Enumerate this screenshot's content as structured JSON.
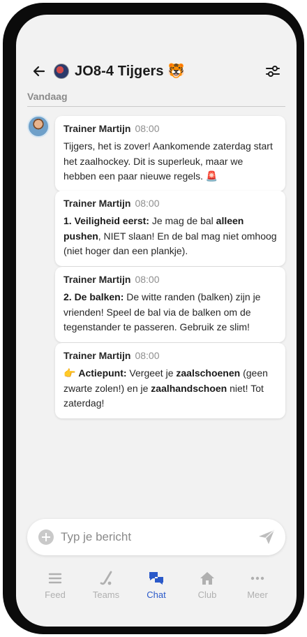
{
  "header": {
    "title": "JO8-4 Tijgers 🐯"
  },
  "chat": {
    "day_label": "Vandaag",
    "messages": [
      {
        "sender": "Trainer Martijn",
        "time": "08:00",
        "parts": [
          {
            "t": "Tijgers, het is zover! Aankomende zaterdag start het zaalhockey. Dit is superleuk, maar we hebben een paar nieuwe regels. 🚨",
            "b": false
          }
        ]
      },
      {
        "sender": "Trainer Martijn",
        "time": "08:00",
        "parts": [
          {
            "t": "1. Veiligheid eerst:",
            "b": true
          },
          {
            "t": " Je mag de bal ",
            "b": false
          },
          {
            "t": "alleen pushen",
            "b": true
          },
          {
            "t": ", NIET slaan! En de bal mag niet omhoog (niet hoger dan een plankje).",
            "b": false
          }
        ]
      },
      {
        "sender": "Trainer Martijn",
        "time": "08:00",
        "parts": [
          {
            "t": "2. De balken:",
            "b": true
          },
          {
            "t": " De witte randen (balken) zijn je vrienden! Speel de bal via de balken om de tegenstander te passeren. Gebruik ze slim!",
            "b": false
          }
        ]
      },
      {
        "sender": "Trainer Martijn",
        "time": "08:00",
        "parts": [
          {
            "t": "👉 ",
            "b": false
          },
          {
            "t": "Actiepunt:",
            "b": true
          },
          {
            "t": " Vergeet je ",
            "b": false
          },
          {
            "t": "zaalschoenen",
            "b": true
          },
          {
            "t": " (geen zwarte zolen!) en je ",
            "b": false
          },
          {
            "t": "zaalhandschoen",
            "b": true
          },
          {
            "t": " niet! Tot zaterdag!",
            "b": false
          }
        ]
      }
    ]
  },
  "composer": {
    "placeholder": "Typ je bericht"
  },
  "tabs": [
    {
      "label": "Feed",
      "icon": "feed-icon",
      "active": false
    },
    {
      "label": "Teams",
      "icon": "hockey-stick-icon",
      "active": false
    },
    {
      "label": "Chat",
      "icon": "chat-bubbles-icon",
      "active": true
    },
    {
      "label": "Club",
      "icon": "home-icon",
      "active": false
    },
    {
      "label": "Meer",
      "icon": "more-dots-icon",
      "active": false
    }
  ],
  "colors": {
    "accent": "#2a59c9",
    "background": "#f2f2f2",
    "inactive_tab": "#b0b0b0"
  }
}
